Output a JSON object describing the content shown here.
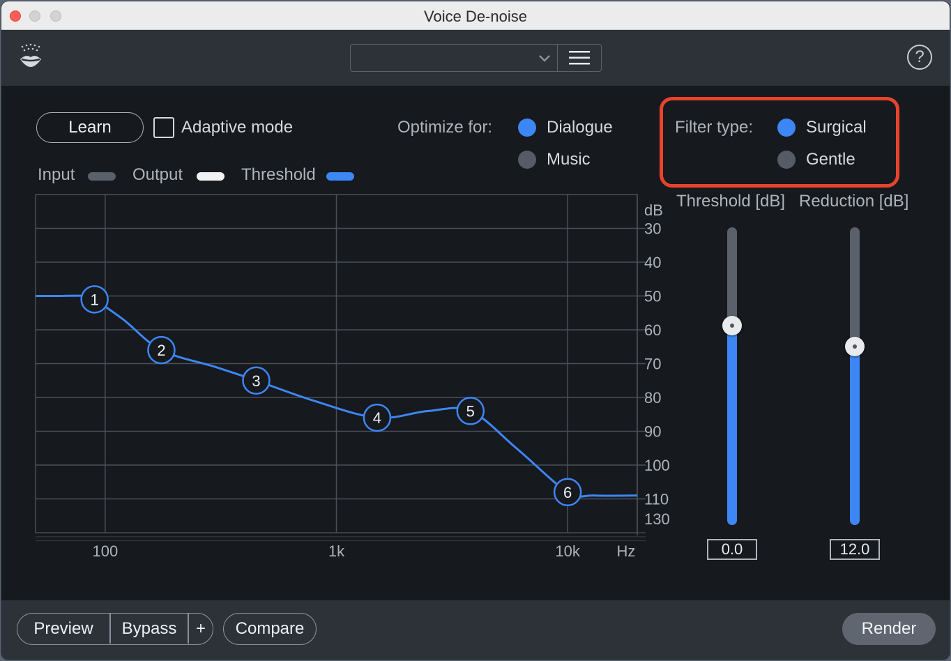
{
  "window": {
    "title": "Voice De-noise"
  },
  "toolbar": {
    "preset_value": "",
    "help_label": "?"
  },
  "controls": {
    "learn_label": "Learn",
    "adaptive_label": "Adaptive mode",
    "adaptive_checked": false,
    "optimize_label": "Optimize for:",
    "optimize_options": [
      "Dialogue",
      "Music"
    ],
    "optimize_selected": "Dialogue",
    "filter_label": "Filter type:",
    "filter_options": [
      "Surgical",
      "Gentle"
    ],
    "filter_selected": "Surgical"
  },
  "legend": {
    "input_label": "Input",
    "input_color": "#5a616b",
    "output_label": "Output",
    "output_color": "#f2f2f2",
    "threshold_label": "Threshold",
    "threshold_color": "#3d86f5"
  },
  "chart_data": {
    "type": "line",
    "x_scale": "log",
    "x_ticks": [
      100,
      1000,
      10000
    ],
    "x_tick_labels": [
      "100",
      "1k",
      "10k"
    ],
    "x_unit_label": "Hz",
    "y_unit_label": "dB",
    "y_ticks": [
      30,
      40,
      50,
      60,
      70,
      80,
      90,
      100,
      110,
      130
    ],
    "y_tick_labels": [
      "30",
      "40",
      "50",
      "60",
      "70",
      "80",
      "90",
      "100",
      "110",
      "130"
    ],
    "series": [
      {
        "color": "#3d86f5",
        "nodes": [
          {
            "label": "1",
            "x": 90,
            "y": 51
          },
          {
            "label": "2",
            "x": 175,
            "y": 66
          },
          {
            "label": "3",
            "x": 450,
            "y": 75
          },
          {
            "label": "4",
            "x": 1500,
            "y": 86
          },
          {
            "label": "5",
            "x": 3800,
            "y": 84
          },
          {
            "label": "6",
            "x": 10000,
            "y": 108
          }
        ],
        "curve": [
          [
            50,
            50
          ],
          [
            60,
            50
          ],
          [
            85,
            50
          ],
          [
            90,
            51
          ],
          [
            120,
            57
          ],
          [
            175,
            66
          ],
          [
            300,
            71
          ],
          [
            450,
            75
          ],
          [
            800,
            81
          ],
          [
            1500,
            86
          ],
          [
            2500,
            84
          ],
          [
            3800,
            84
          ],
          [
            6000,
            95
          ],
          [
            10000,
            108
          ],
          [
            13000,
            109
          ],
          [
            20000,
            109
          ]
        ]
      }
    ]
  },
  "sliders": {
    "threshold": {
      "label": "Threshold [dB]",
      "value_text": "0.0",
      "level": 0.67
    },
    "reduction": {
      "label": "Reduction [dB]",
      "value_text": "12.0",
      "level": 0.6
    }
  },
  "bottombar": {
    "preview_label": "Preview",
    "bypass_label": "Bypass",
    "plus_label": "+",
    "compare_label": "Compare",
    "render_label": "Render"
  }
}
